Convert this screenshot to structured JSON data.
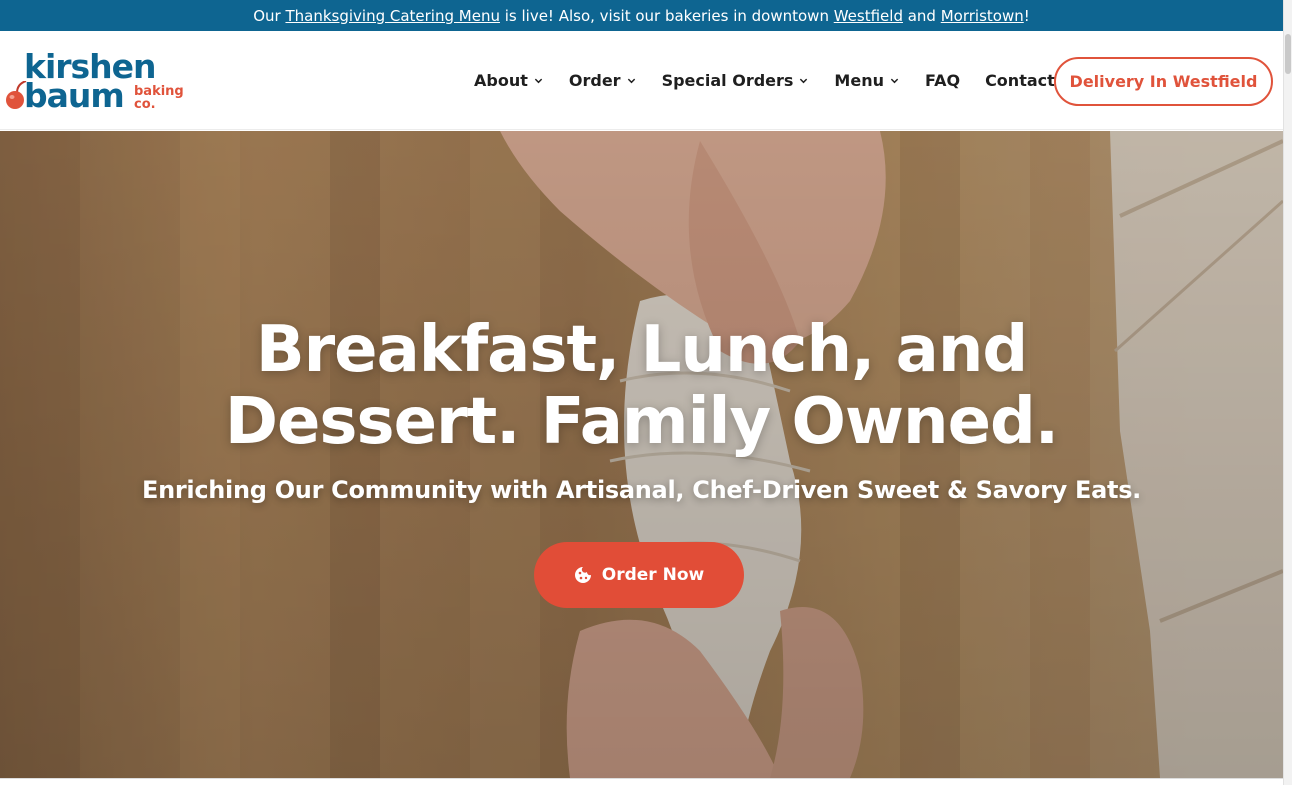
{
  "announcement": {
    "pre": "Our ",
    "link1": "Thanksgiving Catering Menu",
    "mid1": " is live! Also, visit our bakeries in downtown ",
    "link2": "Westfield",
    "mid2": " and ",
    "link3": "Morristown",
    "post": "!"
  },
  "logo": {
    "line1": "kirshen",
    "line2": "baum",
    "line3a": "baking",
    "line3b": "co."
  },
  "nav": {
    "items": [
      {
        "label": "About",
        "dropdown": true
      },
      {
        "label": "Order",
        "dropdown": true
      },
      {
        "label": "Special Orders",
        "dropdown": true
      },
      {
        "label": "Menu",
        "dropdown": true
      },
      {
        "label": "FAQ",
        "dropdown": false
      },
      {
        "label": "Contact",
        "dropdown": true
      }
    ],
    "cta": "Delivery In Westfield"
  },
  "hero": {
    "title_line1": "Breakfast, Lunch, and",
    "title_line2": "Dessert. Family Owned.",
    "subtitle": "Enriching Our Community with Artisanal, Chef-Driven Sweet & Savory Eats.",
    "button_label": "Order Now",
    "button_icon": "cookie-icon"
  },
  "colors": {
    "brand_blue": "#0e6591",
    "accent_red": "#e14d37"
  }
}
